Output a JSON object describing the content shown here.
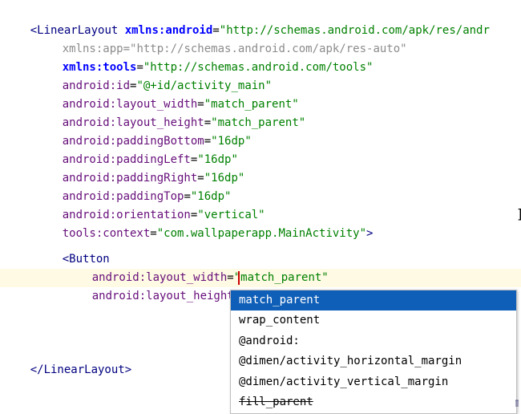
{
  "editor": {
    "lines": [
      {
        "id": "l1",
        "open": "<",
        "tag": "LinearLayout",
        "space": " ",
        "ns": "xmlns:android",
        "eq": "=",
        "value": "\"http://schemas.android.com/apk/res/andr"
      },
      {
        "id": "l2",
        "name": "xmlns:app",
        "eq": "=",
        "value": "\"http://schemas.android.com/apk/res-auto\""
      },
      {
        "id": "l3",
        "name": "xmlns:tools",
        "eq": "=",
        "value": "\"http://schemas.android.com/tools\""
      },
      {
        "id": "l4",
        "name": "android:id",
        "eq": "=",
        "value": "\"@+id/activity_main\""
      },
      {
        "id": "l5",
        "name": "android:layout_width",
        "eq": "=",
        "value": "\"match_parent\""
      },
      {
        "id": "l6",
        "name": "android:layout_height",
        "eq": "=",
        "value": "\"match_parent\""
      },
      {
        "id": "l7",
        "name": "android:paddingBottom",
        "eq": "=",
        "value": "\"16dp\""
      },
      {
        "id": "l8",
        "name": "android:paddingLeft",
        "eq": "=",
        "value": "\"16dp\""
      },
      {
        "id": "l9",
        "name": "android:paddingRight",
        "eq": "=",
        "value": "\"16dp\""
      },
      {
        "id": "l10",
        "name": "android:paddingTop",
        "eq": "=",
        "value": "\"16dp\""
      },
      {
        "id": "l11",
        "name": "android:orientation",
        "eq": "=",
        "value": "\"vertical\""
      },
      {
        "id": "l12",
        "name": "tools:context",
        "eq": "=",
        "value": "\"com.wallpaperapp.MainActivity\"",
        "close": ">"
      },
      {
        "id": "l13",
        "open": "<",
        "tag": "Button"
      },
      {
        "id": "l14",
        "name": "android:layout_width",
        "eq": "=",
        "value": "\"match_parent\""
      },
      {
        "id": "l15",
        "name": "android:layout_height",
        "eq": "=",
        "value": "\"",
        "value2": "\"",
        "close": " />"
      },
      {
        "id": "l16",
        "open": "</",
        "tag": "LinearLayout",
        "close": ">"
      }
    ],
    "bracket_mark": "]"
  },
  "autocomplete": {
    "items": [
      {
        "label": "match_parent",
        "selected": true
      },
      {
        "label": "wrap_content"
      },
      {
        "label": "@android:"
      },
      {
        "label": "@dimen/activity_horizontal_margin"
      },
      {
        "label": "@dimen/activity_vertical_margin"
      },
      {
        "label": "fill_parent",
        "deprecated": true
      }
    ],
    "scroll_glyph": "π"
  }
}
